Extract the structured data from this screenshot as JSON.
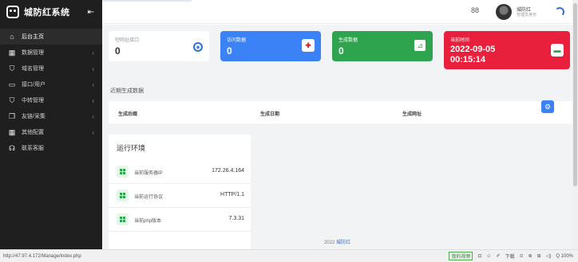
{
  "brand": {
    "name": "城防红系统",
    "collapse_icon": "⇤"
  },
  "sidebar": {
    "items": [
      {
        "label": "后台主页",
        "icon": "⌂",
        "icon_name": "home-icon",
        "active": true,
        "chevron": ""
      },
      {
        "label": "数据管理",
        "icon": "▦",
        "icon_name": "grid-icon",
        "chevron": "‹"
      },
      {
        "label": "域名管理",
        "icon": "⛉",
        "icon_name": "cart-icon",
        "chevron": "‹"
      },
      {
        "label": "接口/用户",
        "icon": "▭",
        "icon_name": "monitor-icon",
        "chevron": "‹"
      },
      {
        "label": "中转管理",
        "icon": "⛉",
        "icon_name": "cart-icon",
        "chevron": "‹"
      },
      {
        "label": "友链/采集",
        "icon": "❐",
        "icon_name": "copy-icon",
        "chevron": "‹"
      },
      {
        "label": "其他配置",
        "icon": "▦",
        "icon_name": "grid-icon",
        "chevron": "‹"
      },
      {
        "label": "联系客服",
        "icon": "☊",
        "icon_name": "headset-icon",
        "chevron": ""
      }
    ]
  },
  "header": {
    "grid_icon": "88",
    "user_name": "城防红",
    "user_role": "管理员身份"
  },
  "cards": {
    "short": {
      "label": "短网址接口",
      "value": "0",
      "icon": "◉"
    },
    "visits": {
      "label": "访问数据",
      "value": "0",
      "icon": "✚"
    },
    "generated": {
      "label": "生成数据",
      "value": "0",
      "icon": "⊿"
    },
    "time": {
      "label": "当前时间",
      "date": "2022-09-05",
      "clock": "00:15:14",
      "icon": "▬"
    }
  },
  "recent": {
    "title": "近期生成数据",
    "columns": [
      "生成后缀",
      "生成日期",
      "生成网址"
    ]
  },
  "env": {
    "title": "运行环境",
    "rows": [
      {
        "key": "当前服务器IP",
        "value": "172.26.4.164"
      },
      {
        "key": "当前运行协议",
        "value": "HTTP/1.1"
      },
      {
        "key": "当前php版本",
        "value": "7.3.31"
      }
    ]
  },
  "footer": {
    "year": "2022",
    "link": "城防红"
  },
  "status": {
    "url": "http://47.97.4.172/Manage/index.php",
    "tools": [
      "我的视频",
      "⊡",
      "☺",
      "✐",
      "下载",
      "⊙",
      "⊕",
      "⊞",
      "◁)",
      "Q 100%"
    ]
  },
  "colors": {
    "blue": "#3b82f6",
    "green": "#2ea44f",
    "red": "#e8203b",
    "sidebar": "#1f1f1f"
  }
}
